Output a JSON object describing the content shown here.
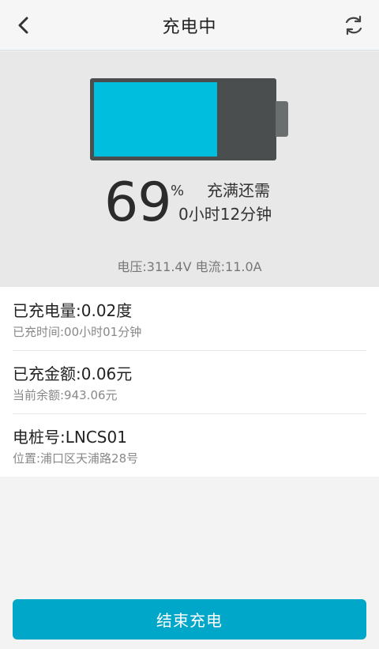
{
  "header": {
    "title": "充电中",
    "back_icon": "chevron-left-icon",
    "refresh_icon": "refresh-icon"
  },
  "battery": {
    "level_percent": 69,
    "fill_color": "#00bedd",
    "empty_color": "#4a4e4f"
  },
  "status": {
    "percent_value": "69",
    "percent_sign": "%",
    "remaining_label": "充满还需",
    "remaining_time": "0小时12分钟",
    "electrics": "电压:311.4V  电流:11.0A"
  },
  "info": {
    "items": [
      {
        "main": "已充电量:0.02度",
        "sub": "已充时间:00小时01分钟"
      },
      {
        "main": "已充金额:0.06元",
        "sub": "当前余额:943.06元"
      },
      {
        "main": "电桩号:LNCS01",
        "sub": "位置:浦口区天浦路28号"
      }
    ]
  },
  "actions": {
    "end_label": "结束充电",
    "accent_color": "#00a7c9"
  }
}
